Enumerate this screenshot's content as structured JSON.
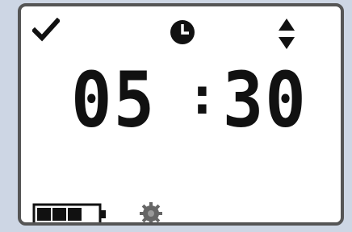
{
  "device": {
    "status_icons": [
      "check-icon",
      "clock-icon",
      "up-down-arrows-icon"
    ],
    "time": {
      "hours": "05",
      "separator": ":",
      "minutes": "30"
    },
    "battery": {
      "icon": "battery-icon",
      "filled_bars": 3,
      "total_bars": 4
    },
    "settings_icon": "gear-icon",
    "colors": {
      "screen_background": "#ffffff",
      "page_background": "#cdd6e4",
      "bezel": "#555555",
      "foreground": "#111111"
    }
  }
}
